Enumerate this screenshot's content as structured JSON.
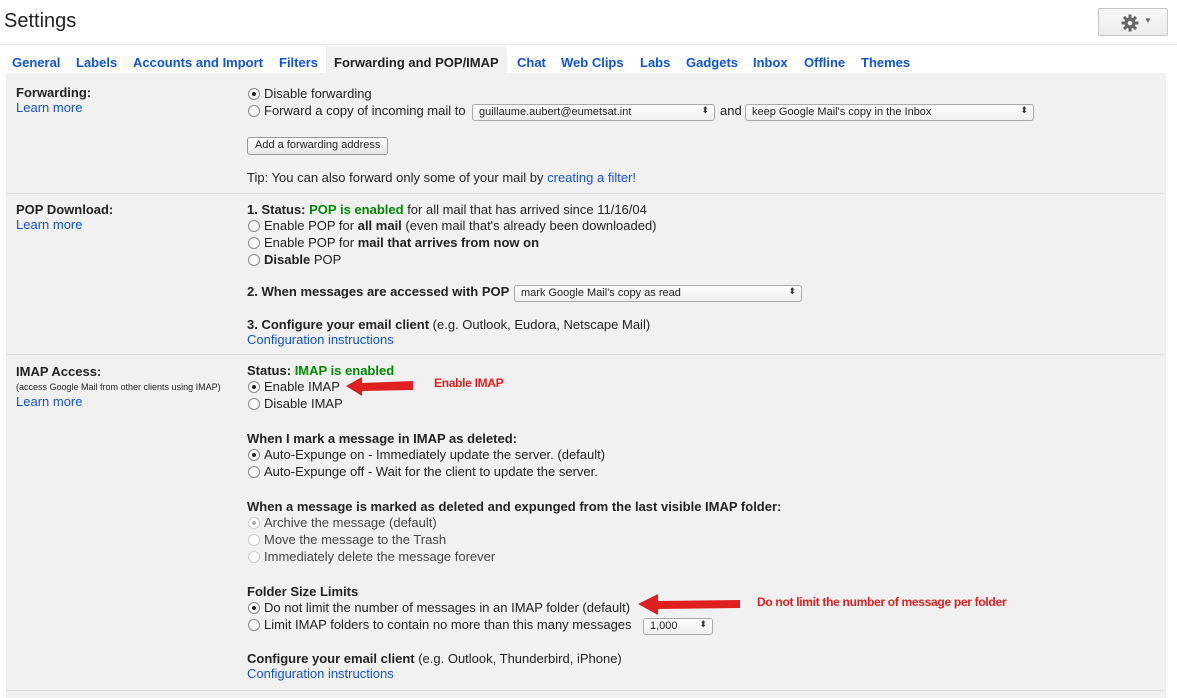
{
  "header": {
    "title": "Settings"
  },
  "tabs": [
    {
      "label": "General"
    },
    {
      "label": "Labels"
    },
    {
      "label": "Accounts and Import"
    },
    {
      "label": "Filters"
    },
    {
      "label": "Forwarding and POP/IMAP"
    },
    {
      "label": "Chat"
    },
    {
      "label": "Web Clips"
    },
    {
      "label": "Labs"
    },
    {
      "label": "Gadgets"
    },
    {
      "label": "Inbox"
    },
    {
      "label": "Offline"
    },
    {
      "label": "Themes"
    }
  ],
  "forwarding": {
    "label": "Forwarding:",
    "learn_more": "Learn more",
    "disable": "Disable forwarding",
    "forward_copy": "Forward a copy of incoming mail to",
    "address": "guillaume.aubert@eumetsat.int",
    "and": "and",
    "keep_option": "keep Google Mail's copy in the Inbox",
    "add_button": "Add a forwarding address",
    "tip": "Tip: You can also forward only some of your mail by",
    "tip_link": "creating a filter!"
  },
  "pop": {
    "label": "POP Download:",
    "learn_more": "Learn more",
    "status_prefix": "1. Status:",
    "status_value": "POP is enabled",
    "status_suffix": "for all mail that has arrived since 11/16/04",
    "opt1_a": "Enable POP for",
    "opt1_b": "all mail",
    "opt1_c": "(even mail that's already been downloaded)",
    "opt2_a": "Enable POP for",
    "opt2_b": "mail that arrives from now on",
    "opt3_a": "Disable",
    "opt3_b": "POP",
    "when_accessed": "2. When messages are accessed with POP",
    "access_option": "mark Google Mail's copy as read",
    "configure_bold": "3. Configure your email client",
    "configure_rest": "(e.g. Outlook, Eudora, Netscape Mail)",
    "config_link": "Configuration instructions"
  },
  "imap": {
    "label": "IMAP Access:",
    "sub": "(access Google Mail from other clients using IMAP)",
    "learn_more": "Learn more",
    "status_prefix": "Status:",
    "status_value": "IMAP is enabled",
    "enable": "Enable IMAP",
    "disable": "Disable IMAP",
    "deleted_heading": "When I mark a message in IMAP as deleted:",
    "expunge_on": "Auto-Expunge on - Immediately update the server. (default)",
    "expunge_off": "Auto-Expunge off - Wait for the client to update the server.",
    "expunged_heading": "When a message is marked as deleted and expunged from the last visible IMAP folder:",
    "archive": "Archive the message (default)",
    "trash": "Move the message to the Trash",
    "delete_forever": "Immediately delete the message forever",
    "folder_heading": "Folder Size Limits",
    "no_limit": "Do not limit the number of messages in an IMAP folder (default)",
    "limit": "Limit IMAP folders to contain no more than this many messages",
    "limit_value": "1,000",
    "configure_bold": "Configure your email client",
    "configure_rest": "(e.g. Outlook, Thunderbird, iPhone)",
    "config_link": "Configuration instructions"
  },
  "annotations": {
    "enable_imap": "Enable IMAP",
    "no_limit": "Do not limit the number of message per folder",
    "color": "#e02020"
  }
}
